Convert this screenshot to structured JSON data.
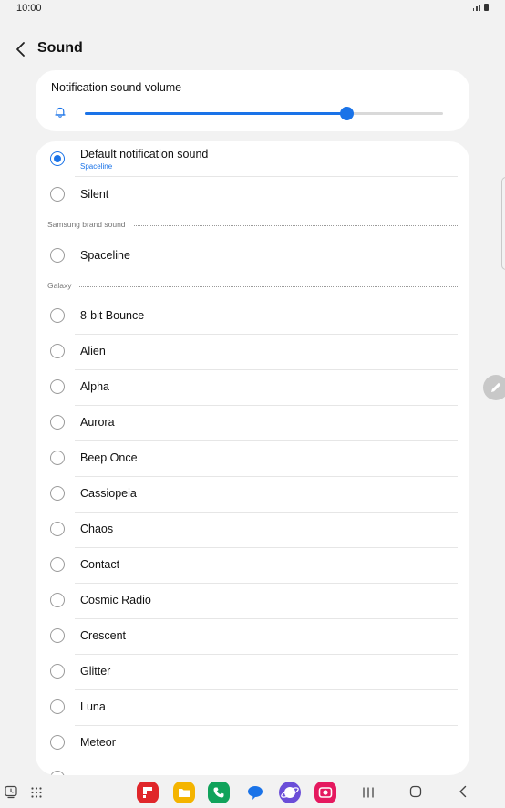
{
  "status_bar": {
    "time": "10:00"
  },
  "header": {
    "title": "Sound"
  },
  "volume": {
    "title": "Notification sound volume",
    "level": 0.73
  },
  "colors": {
    "accent": "#1a73e8",
    "background": "#f2f2f2",
    "card": "#ffffff"
  },
  "options": {
    "default": {
      "label": "Default notification sound",
      "sublabel": "Spaceline",
      "selected": true
    },
    "silent": {
      "label": "Silent",
      "selected": false
    }
  },
  "sections": {
    "samsung": {
      "label": "Samsung brand sound",
      "items": [
        "Spaceline"
      ]
    },
    "galaxy": {
      "label": "Galaxy",
      "items": [
        "8-bit Bounce",
        "Alien",
        "Alpha",
        "Aurora",
        "Beep Once",
        "Cassiopeia",
        "Chaos",
        "Contact",
        "Cosmic Radio",
        "Crescent",
        "Glitter",
        "Luna",
        "Meteor"
      ]
    }
  },
  "nav_bar": {
    "left_icons": [
      "recent-apps-clock-icon",
      "app-drawer-grid-icon"
    ],
    "apps": [
      {
        "name": "flipboard-app-icon",
        "color": "#e0262a"
      },
      {
        "name": "my-files-app-icon",
        "color": "#f4b400"
      },
      {
        "name": "phone-app-icon",
        "color": "#11a35b"
      },
      {
        "name": "messages-app-icon",
        "color": "#1a73e8"
      },
      {
        "name": "internet-app-icon",
        "color": "#6b4ed8"
      },
      {
        "name": "camera-app-icon",
        "color": "#e5195f"
      }
    ],
    "buttons": [
      "recents-icon",
      "home-icon",
      "back-icon"
    ]
  }
}
